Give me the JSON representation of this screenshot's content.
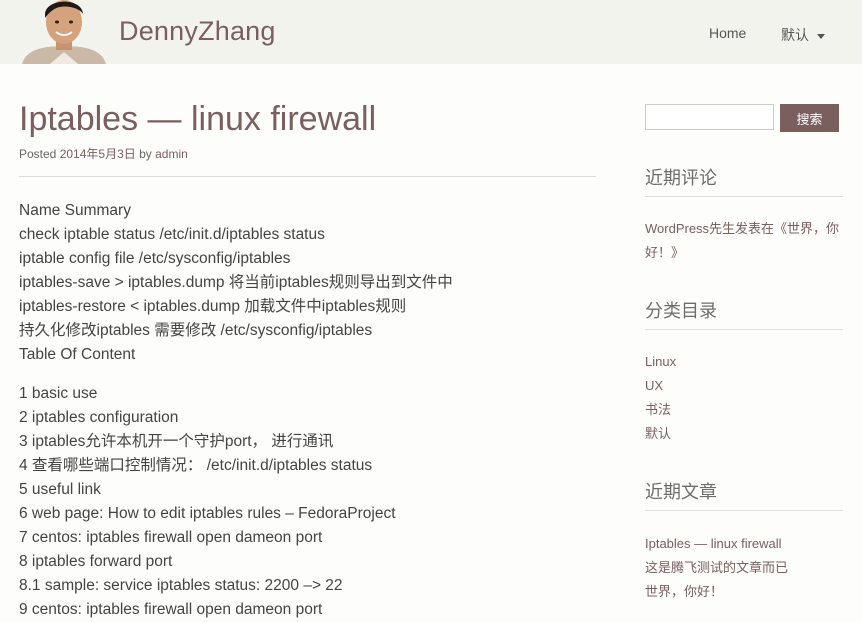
{
  "site": {
    "brand": "DennyZhang",
    "nav": [
      {
        "label": "Home"
      },
      {
        "label": "默认"
      }
    ]
  },
  "post": {
    "title": "Iptables — linux firewall",
    "meta_prefix": "Posted ",
    "date": "2014年5月3日",
    "meta_by": " by ",
    "author": "admin",
    "summary_lines": [
      "Name Summary",
      "check iptable status /etc/init.d/iptables status",
      "iptable config file /etc/sysconfig/iptables",
      "iptables-save > iptables.dump 将当前iptables规则导出到文件中",
      "iptables-restore < iptables.dump 加载文件中iptables规则",
      "持久化修改iptables 需要修改 /etc/sysconfig/iptables",
      "Table Of Content"
    ],
    "toc_lines": [
      "1 basic use",
      "2 iptables configuration",
      "3 iptables允许本机开一个守护port， 进行通讯",
      "4 查看哪些端口控制情况：   /etc/init.d/iptables status",
      "5 useful link",
      "6 web page: How to edit iptables rules – FedoraProject",
      "7 centos: iptables firewall open dameon port",
      "8 iptables forward port",
      "8.1 sample: service iptables status: 2200 –> 22",
      "9 centos: iptables firewall open dameon port"
    ]
  },
  "sidebar": {
    "search": {
      "placeholder": "",
      "button_label": "搜索"
    },
    "recent_comments": {
      "title": "近期评论",
      "items": [
        "WordPress先生发表在《世界，你",
        "好！》"
      ]
    },
    "categories": {
      "title": "分类目录",
      "items": [
        "Linux",
        "UX",
        "书法",
        "默认"
      ]
    },
    "recent_posts": {
      "title": "近期文章",
      "items": [
        "Iptables — linux firewall",
        "这是腾飞测试的文章而已",
        "世界，你好！"
      ]
    }
  }
}
